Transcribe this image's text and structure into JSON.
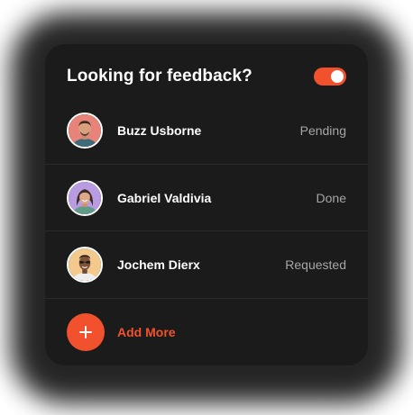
{
  "header": {
    "title": "Looking for feedback?",
    "toggle_on": true
  },
  "requests": [
    {
      "name": "Buzz Usborne",
      "status": "Pending",
      "avatar_bg": "#e8837a"
    },
    {
      "name": "Gabriel Valdivia",
      "status": "Done",
      "avatar_bg": "#b89be0"
    },
    {
      "name": "Jochem Dierx",
      "status": "Requested",
      "avatar_bg": "#f4c98e"
    }
  ],
  "add_more": {
    "label": "Add More"
  },
  "colors": {
    "card_bg": "#1b1b1b",
    "accent": "#f1522d",
    "status_text": "#a6a6a6",
    "divider": "#2a2a2a"
  }
}
